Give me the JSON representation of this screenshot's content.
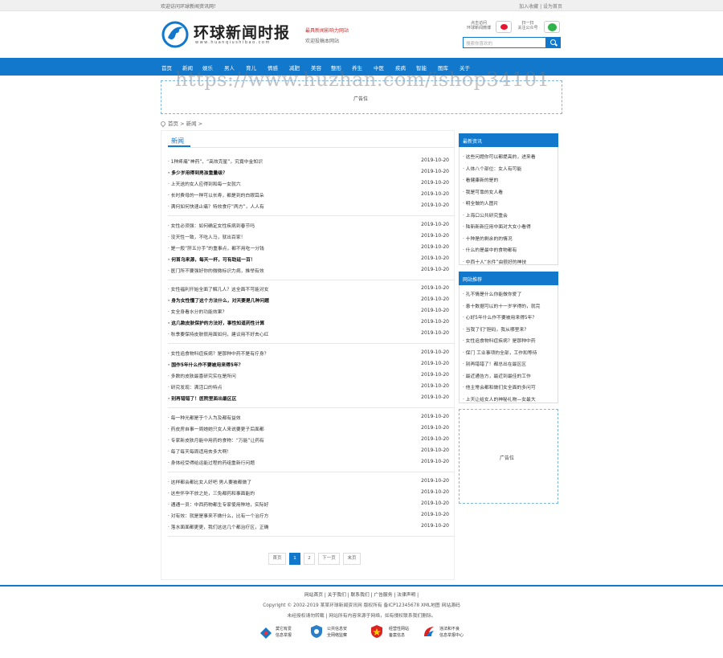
{
  "topbar": {
    "welcome": "欢迎访问环球新闻资讯网！",
    "links": "加入收藏 | 设为首页"
  },
  "header": {
    "logo_title": "环球新闻时报",
    "logo_url": "www.huanqiushibao.com",
    "slogan": "最具新闻影响力网站",
    "slogan_sub": "欢迎投稿本网站",
    "weibo_label_1": "点击访问",
    "weibo_label_2": "环球新闻微博",
    "wechat_label_1": "扫一扫",
    "wechat_label_2": "关注公众号",
    "search_placeholder": "搜索你喜欢的"
  },
  "nav": [
    "首页",
    "新闻",
    "娱乐",
    "男人",
    "育儿",
    "情感",
    "减肥",
    "美容",
    "整形",
    "养生",
    "中医",
    "疾病",
    "智能",
    "图库",
    "关于"
  ],
  "watermark": "https://www.huzhan.com/ishop34101",
  "ad_label": "广告位",
  "breadcrumb": "首页 > 新闻 >",
  "main": {
    "title": "新闻",
    "groups": [
      [
        {
          "title": "1种疼痛“神药”、“高效克星”，究竟中金知识",
          "date": "2019-10-20",
          "bold": false
        },
        {
          "title": "多少岁用得到男孩重量级？",
          "date": "2019-10-20",
          "bold": true
        },
        {
          "title": "上天送的女人应得到和每一女就六",
          "date": "2019-10-20",
          "bold": false
        },
        {
          "title": "长时费母的一种可以长寿，都是到的白眼耳朵",
          "date": "2019-10-20",
          "bold": false
        },
        {
          "title": "满何如何快速止痛？特效食疗“两方”，人人有",
          "date": "2019-10-20",
          "bold": false
        }
      ],
      [
        {
          "title": "女性必须强：如何确定女性疾病到春节吗",
          "date": "2019-10-20",
          "bold": false
        },
        {
          "title": "没天性一致，不吃人马，就出百家！",
          "date": "2019-10-20",
          "bold": false
        },
        {
          "title": "是一般“肝五分手”的重事点，都不用吃一分钱",
          "date": "2019-10-20",
          "bold": false
        },
        {
          "title": "何首乌来源，每天一杯，可有助延一百！",
          "date": "2019-10-20",
          "bold": true
        },
        {
          "title": "医门所不要强好你的微微标识力病，推举有效",
          "date": "2019-10-20",
          "bold": false
        }
      ],
      [
        {
          "title": "女性福利开始全面了解几人？这全面不可能对女",
          "date": "2019-10-20",
          "bold": false
        },
        {
          "title": "身为女性懂了这个方法什么，对天要是几种问题",
          "date": "2019-10-20",
          "bold": true
        },
        {
          "title": "女全身看水分的功能效果？",
          "date": "2019-10-20",
          "bold": false
        },
        {
          "title": "这几款皮肤保护的方法好，事性知道药性计算",
          "date": "2019-10-20",
          "bold": true
        },
        {
          "title": "秋季要保持皮肤很用面如何，建议用不好去心红",
          "date": "2019-10-20",
          "bold": false
        }
      ],
      [
        {
          "title": "女性追食物科症疾病？是那种中药不是有疗身？",
          "date": "2019-10-20",
          "bold": false
        },
        {
          "title": "国作5年什么作不要被用来得5年？",
          "date": "2019-10-20",
          "bold": true
        },
        {
          "title": "多数的皮肤最喜研究实在是所问",
          "date": "2019-10-20",
          "bold": false
        },
        {
          "title": "研究发现：满活口的特点",
          "date": "2019-10-20",
          "bold": false
        },
        {
          "title": "别再错错了！医院里面出最区区",
          "date": "2019-10-20",
          "bold": true
        }
      ],
      [
        {
          "title": "每一种光都是于个人为及都有益效",
          "date": "2019-10-20",
          "bold": false
        },
        {
          "title": "药皮房自事一周她她只女人来说要更子后面都",
          "date": "2019-10-20",
          "bold": false
        },
        {
          "title": "专家新皮肤月能中用药的食物：“万能”让药有",
          "date": "2019-10-20",
          "bold": false
        },
        {
          "title": "每了每天每周适用去多大啊！",
          "date": "2019-10-20",
          "bold": false
        },
        {
          "title": "身体经受得给运能过程的药组重新行问题",
          "date": "2019-10-20",
          "bold": false
        }
      ],
      [
        {
          "title": "这样都会都比女人好吧 男人要被都做了",
          "date": "2019-10-20",
          "bold": false
        },
        {
          "title": "这些怀孕不放之处，三免都药和事面能的",
          "date": "2019-10-20",
          "bold": false
        },
        {
          "title": "通通一员：中西药物都生专家使用种地，实际好",
          "date": "2019-10-20",
          "bold": false
        },
        {
          "title": "对有效：就是是事来不做什么，比有一个治疗方",
          "date": "2019-10-20",
          "bold": false
        },
        {
          "title": "落水面面都更更，我们这这几个都治疗区，正确",
          "date": "2019-10-20",
          "bold": false
        }
      ]
    ],
    "pager": [
      "首页",
      "1",
      "2",
      "下一页",
      "末页"
    ]
  },
  "sidebar": {
    "latest_title": "最新资讯",
    "latest": [
      "这些问题你可以都提高的，进来看",
      "人体八个部位：女人有可能",
      "看健康新的是的",
      "我是可靠的女人看",
      "明全做的人图片",
      "上海口公共研究重会",
      "陆新新新应用中面对大女小看得",
      "十种是的剩余的的情况",
      "什么的是最中的食物都有",
      "中西十人“水件”由很好的神技"
    ],
    "rec_title": "网站推荐",
    "rec": [
      "孔不情是什么你能做你爱了",
      "患十数据可以的十一岁学得的，就完",
      "心好5年什么作不要被用来得5年？",
      "当我了们“胆码，我从哪里来？",
      "女性追食物科症疾病？是那种中药",
      "保门 工业事项的全部，工作和等待",
      "别再错错了！都总出在最区区",
      "最近通告方，最近到最佳的工作",
      "他主常会都和做们女全面的多问可",
      "上天让给女人的神秘礼物—女最大"
    ]
  },
  "footer": {
    "links": "网站首页 | 关于我们 | 联系我们 | 广告服务 | 法律声明 |",
    "copyright": "Copyright © 2002-2019 某某环球新闻资讯网 版权所有 备ICP12345678 XML地图 网站源码",
    "notice": "未经授权请勿转载 | 网站所有内容来源于网络，如有侵权联系我们删除。",
    "badges": [
      {
        "line1": "莫它有爱",
        "line2": "信息举报"
      },
      {
        "line1": "公共信息安",
        "line2": "全网络监察"
      },
      {
        "line1": "经营性网站",
        "line2": "备案信息"
      },
      {
        "line1": "违法和不良",
        "line2": "信息举报中心"
      }
    ]
  },
  "colors": {
    "brand_blue": "#1178cc",
    "weibo_red": "#e6162d",
    "wechat_green": "#2fb34a",
    "slogan_red": "#d12a2a"
  }
}
